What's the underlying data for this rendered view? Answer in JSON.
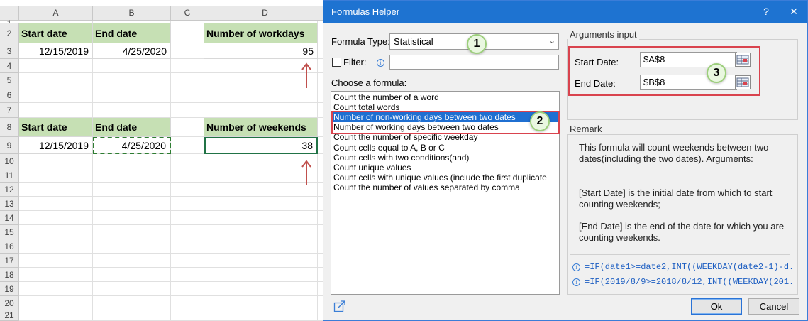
{
  "spreadsheet": {
    "columns": [
      "A",
      "B",
      "C",
      "D"
    ],
    "rows": [
      "1",
      "2",
      "3",
      "4",
      "5",
      "6",
      "7",
      "8",
      "9",
      "10",
      "11",
      "12",
      "13",
      "14",
      "15",
      "16",
      "17",
      "18",
      "19",
      "20",
      "21"
    ],
    "table1": {
      "start_header": "Start date",
      "end_header": "End date",
      "result_header": "Number of workdays",
      "start_value": "12/15/2019",
      "end_value": "4/25/2020",
      "result_value": "95"
    },
    "table2": {
      "start_header": "Start date",
      "end_header": "End date",
      "result_header": "Number of weekends",
      "start_value": "12/15/2019",
      "end_value": "4/25/2020",
      "result_value": "38"
    }
  },
  "dialog": {
    "title": "Formulas Helper",
    "help_label": "?",
    "close_label": "✕",
    "formula_type_label": "Formula Type:",
    "formula_type_value": "Statistical",
    "filter_label": "Filter:",
    "filter_value": "",
    "choose_label": "Choose a formula:",
    "formulas": [
      "Count the number of a word",
      "Count total words",
      "Number of non-working days between two dates",
      "Number of working days between two dates",
      "Count the number of specific weekday",
      "Count cells equal to A, B or C",
      "Count cells with two conditions(and)",
      "Count unique values",
      "Count cells with unique values (include the first duplicate",
      "Count the number of values separated by comma"
    ],
    "selected_index": 2,
    "arguments_title": "Arguments input",
    "start_date_label": "Start Date:",
    "start_date_value": "$A$8",
    "end_date_label": "End Date:",
    "end_date_value": "$B$8",
    "remark_title": "Remark",
    "remark_lines": [
      "This formula will count weekends between two",
      "dates(including the two dates). Arguments:",
      "[Start Date] is the initial date from which to start",
      "counting weekends;",
      "[End Date] is the end of the date for which you are",
      "counting weekends."
    ],
    "examples": [
      "=IF(date1>=date2,INT((WEEKDAY(date2-1)-d...",
      "=IF(2019/8/9>=2018/8/12,INT((WEEKDAY(201..."
    ],
    "ok_label": "Ok",
    "cancel_label": "Cancel"
  },
  "badges": [
    "1",
    "2",
    "3"
  ],
  "colors": {
    "header_fill": "#c6e0b4",
    "title_bar": "#1e73d1",
    "selection": "#1f6fd1",
    "highlight_border": "#d9434e",
    "arrow": "#c0504d"
  }
}
